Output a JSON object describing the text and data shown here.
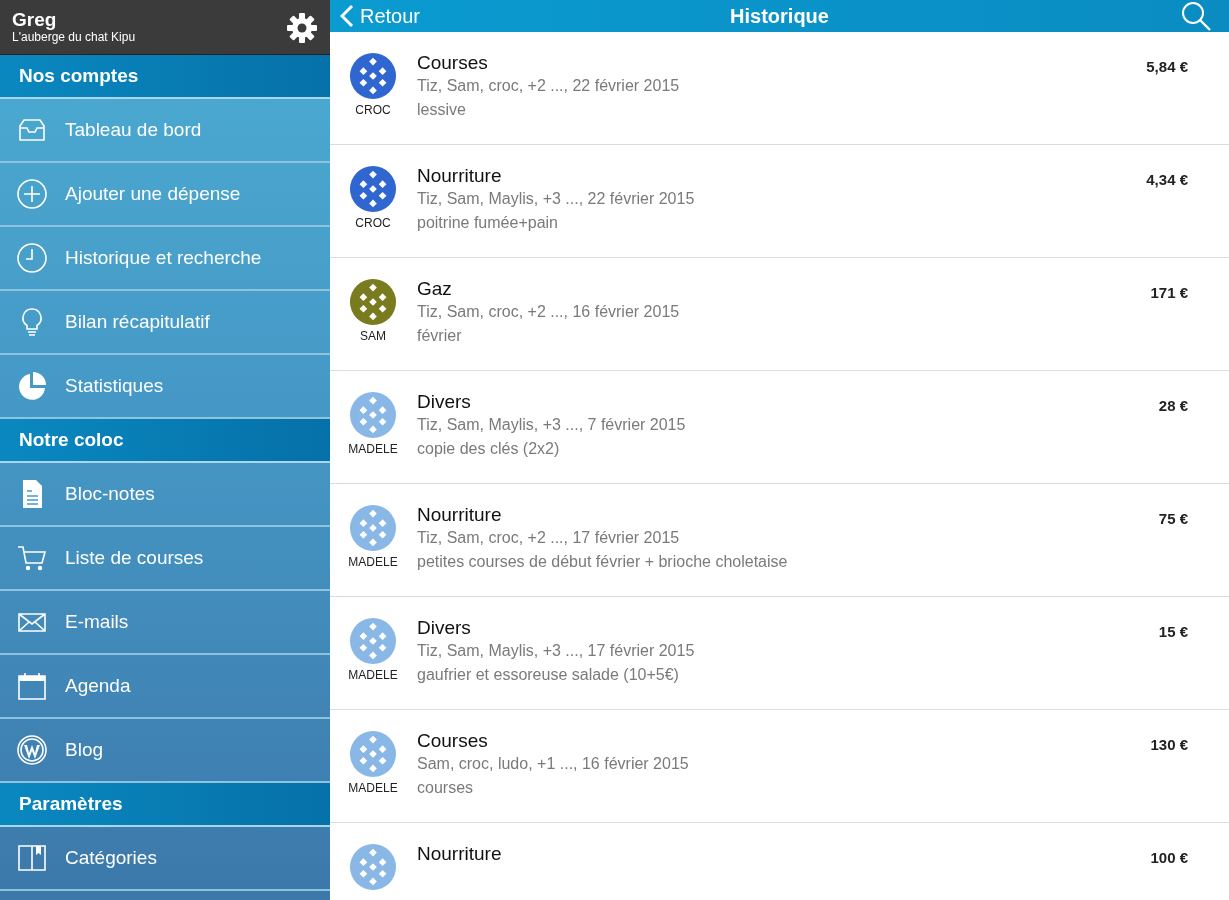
{
  "account": {
    "name": "Greg",
    "subtitle": "L'auberge du chat Kipu"
  },
  "sidebar": {
    "sections": [
      {
        "header": "Nos comptes",
        "items": [
          {
            "label": "Tableau de bord"
          },
          {
            "label": "Ajouter une dépense"
          },
          {
            "label": "Historique et recherche"
          },
          {
            "label": "Bilan récapitulatif"
          },
          {
            "label": "Statistiques"
          }
        ]
      },
      {
        "header": "Notre coloc",
        "items": [
          {
            "label": "Bloc-notes"
          },
          {
            "label": "Liste de courses"
          },
          {
            "label": "E-mails"
          },
          {
            "label": "Agenda"
          },
          {
            "label": "Blog"
          }
        ]
      },
      {
        "header": "Paramètres",
        "items": [
          {
            "label": "Catégories"
          }
        ]
      }
    ]
  },
  "topbar": {
    "back": "Retour",
    "title": "Historique"
  },
  "expenses": [
    {
      "category": "Courses",
      "people": "Tiz, Sam, croc, +2 ..., 22 février 2015",
      "note": "lessive",
      "amount": "5,84 €",
      "payer": "CROC",
      "color": "#2f66d0"
    },
    {
      "category": "Nourriture",
      "people": "Tiz, Sam, Maylis, +3 ..., 22 février 2015",
      "note": "poitrine fumée+pain",
      "amount": "4,34 €",
      "payer": "CROC",
      "color": "#2f66d0"
    },
    {
      "category": "Gaz",
      "people": "Tiz, Sam, croc, +2 ..., 16 février 2015",
      "note": "février",
      "amount": "171 €",
      "payer": "SAM",
      "color": "#7a7a1e"
    },
    {
      "category": "Divers",
      "people": "Tiz, Sam, Maylis, +3 ..., 7 février 2015",
      "note": "copie des clés (2x2)",
      "amount": "28 €",
      "payer": "MADELE",
      "color": "#8ab8e6"
    },
    {
      "category": "Nourriture",
      "people": "Tiz, Sam, croc, +2 ..., 17 février 2015",
      "note": "petites courses de début février + brioche choletaise",
      "amount": "75 €",
      "payer": "MADELE",
      "color": "#8ab8e6"
    },
    {
      "category": "Divers",
      "people": "Tiz, Sam, Maylis, +3 ..., 17 février 2015",
      "note": "gaufrier et essoreuse salade (10+5€)",
      "amount": "15 €",
      "payer": "MADELE",
      "color": "#8ab8e6"
    },
    {
      "category": "Courses",
      "people": "Sam, croc, ludo, +1 ..., 16 février 2015",
      "note": "courses",
      "amount": "130 €",
      "payer": "MADELE",
      "color": "#8ab8e6"
    },
    {
      "category": "Nourriture",
      "amount": "100 €",
      "color": "#8ab8e6"
    }
  ]
}
